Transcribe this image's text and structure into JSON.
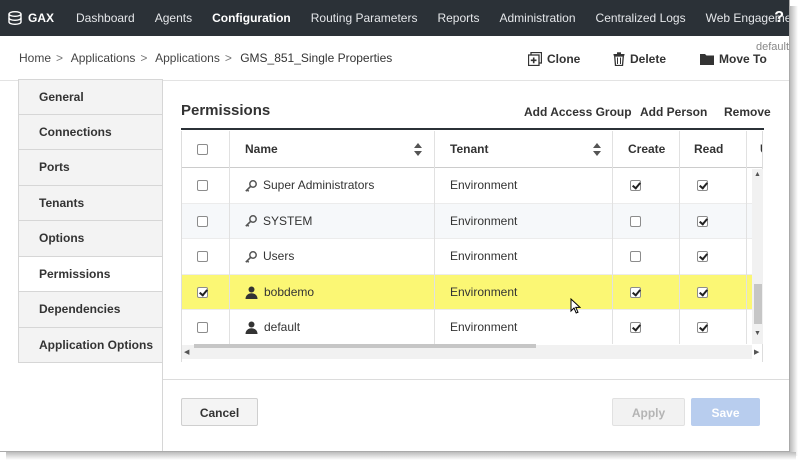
{
  "app": {
    "logo_text": "GAX"
  },
  "nav": {
    "items": [
      "Dashboard",
      "Agents",
      "Configuration",
      "Routing Parameters",
      "Reports",
      "Administration",
      "Centralized Logs",
      "Web Engagement"
    ],
    "active": "Configuration",
    "help": "?"
  },
  "breadcrumb": [
    "Home",
    "Applications",
    "Applications",
    "GMS_851_Single Properties"
  ],
  "breadcrumb_sep": ">",
  "default_tag": "default",
  "actions": {
    "clone": "Clone",
    "delete": "Delete",
    "move_to": "Move To"
  },
  "sidebar": {
    "items": [
      "General",
      "Connections",
      "Ports",
      "Tenants",
      "Options",
      "Permissions",
      "Dependencies",
      "Application Options"
    ],
    "active": "Permissions"
  },
  "panel": {
    "title": "Permissions",
    "add_access_group": "Add Access Group",
    "add_person": "Add Person",
    "remove": "Remove"
  },
  "table": {
    "columns": {
      "name": "Name",
      "tenant": "Tenant",
      "create": "Create",
      "read": "Read",
      "clipped": "U"
    },
    "rows": [
      {
        "icon": "key-icon",
        "name": "Super Administrators",
        "tenant": "Environment",
        "selected": false,
        "create": true,
        "read": true
      },
      {
        "icon": "key-icon",
        "name": "SYSTEM",
        "tenant": "Environment",
        "selected": false,
        "create": false,
        "read": true
      },
      {
        "icon": "key-icon",
        "name": "Users",
        "tenant": "Environment",
        "selected": false,
        "create": false,
        "read": true
      },
      {
        "icon": "person-icon",
        "name": "bobdemo",
        "tenant": "Environment",
        "selected": true,
        "create": true,
        "read": true
      },
      {
        "icon": "person-icon",
        "name": "default",
        "tenant": "Environment",
        "selected": false,
        "create": true,
        "read": true
      }
    ]
  },
  "footer": {
    "cancel": "Cancel",
    "apply": "Apply",
    "save": "Save"
  },
  "colors": {
    "nav_bg": "#2b3137",
    "selected_row": "#fbf774",
    "save_bg": "#b8cdee"
  }
}
